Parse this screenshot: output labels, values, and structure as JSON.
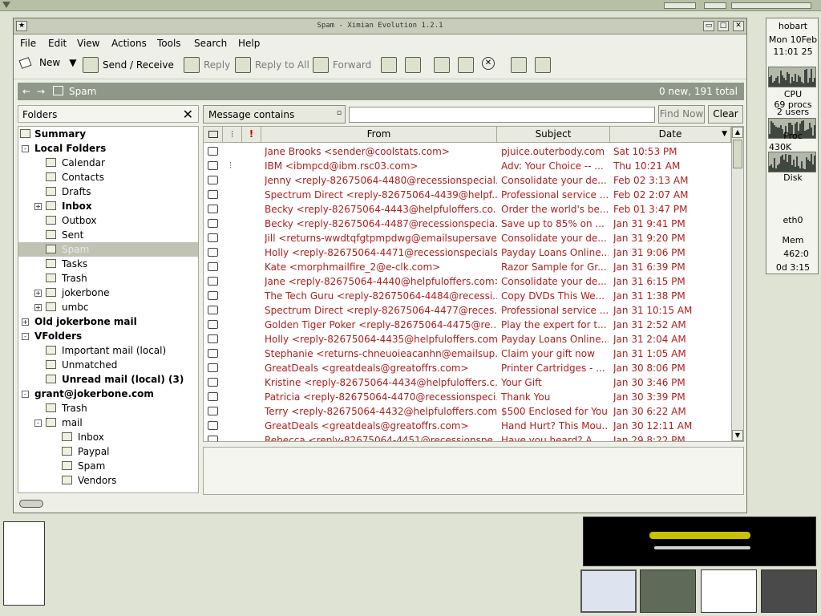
{
  "window": {
    "title": "Spam - Ximian Evolution 1.2.1"
  },
  "menu": [
    "File",
    "Edit",
    "View",
    "Actions",
    "Tools",
    "Search",
    "Help"
  ],
  "toolbar": {
    "new": "New",
    "send_receive": "Send / Receive",
    "reply": "Reply",
    "reply_all": "Reply to All",
    "forward": "Forward"
  },
  "pathbar": {
    "folder": "Spam",
    "status": "0 new, 191 total"
  },
  "sidebar": {
    "title": "Folders",
    "items": [
      {
        "label": "Summary",
        "bold": true,
        "level": 0
      },
      {
        "label": "Local Folders",
        "bold": true,
        "level": 0,
        "expander": "-"
      },
      {
        "label": "Calendar",
        "level": 1
      },
      {
        "label": "Contacts",
        "level": 1
      },
      {
        "label": "Drafts",
        "level": 1
      },
      {
        "label": "Inbox",
        "bold": true,
        "level": 1,
        "expander": "+"
      },
      {
        "label": "Outbox",
        "level": 1
      },
      {
        "label": "Sent",
        "level": 1
      },
      {
        "label": "Spam",
        "level": 1,
        "selected": true
      },
      {
        "label": "Tasks",
        "level": 1
      },
      {
        "label": "Trash",
        "level": 1
      },
      {
        "label": "jokerbone",
        "level": 1,
        "expander": "+"
      },
      {
        "label": "umbc",
        "level": 1,
        "expander": "+"
      },
      {
        "label": "Old jokerbone mail",
        "bold": true,
        "level": 0,
        "expander": "+"
      },
      {
        "label": "VFolders",
        "bold": true,
        "level": 0,
        "expander": "-"
      },
      {
        "label": "Important mail (local)",
        "level": 1
      },
      {
        "label": "Unmatched",
        "level": 1
      },
      {
        "label": "Unread mail (local) (3)",
        "bold": true,
        "level": 1
      },
      {
        "label": "grant@jokerbone.com",
        "bold": true,
        "level": 0,
        "expander": "-"
      },
      {
        "label": "Trash",
        "level": 1
      },
      {
        "label": "mail",
        "level": 1,
        "expander": "-"
      },
      {
        "label": "Inbox",
        "level": 2
      },
      {
        "label": "Paypal",
        "level": 2
      },
      {
        "label": "Spam",
        "level": 2
      },
      {
        "label": "Vendors",
        "level": 2
      }
    ]
  },
  "search": {
    "scope": "Message contains",
    "value": "",
    "find_now": "Find Now",
    "clear": "Clear"
  },
  "messages": {
    "columns": [
      "From",
      "Subject",
      "Date"
    ],
    "rows": [
      {
        "from": "Jane Brooks <sender@coolstats.com>",
        "subject": "pjuice.outerbody.com",
        "date": "Sat 10:53 PM",
        "attach": false
      },
      {
        "from": "IBM <ibmpcd@ibm.rsc03.com>",
        "subject": "Adv: Your Choice -- ...",
        "date": "Thu 10:21 AM",
        "attach": true
      },
      {
        "from": "Jenny <reply-82675064-4480@recessionspecial...",
        "subject": "Consolidate your de...",
        "date": "Feb 02 3:13 AM",
        "attach": false
      },
      {
        "from": "Spectrum Direct <reply-82675064-4439@helpf...",
        "subject": "Professional service ...",
        "date": "Feb 02 2:07 AM",
        "attach": false
      },
      {
        "from": "Becky <reply-82675064-4443@helpfuloffers.co...",
        "subject": "Order the world's be...",
        "date": "Feb 01 3:47 PM",
        "attach": false
      },
      {
        "from": "Becky <reply-82675064-4487@recessionspecia...",
        "subject": "Save up to 85% on ...",
        "date": "Jan 31 9:41 PM",
        "attach": false
      },
      {
        "from": "Jill <returns-wwdtqfgtpmpdwg@emailsupersave...",
        "subject": "Consolidate your de...",
        "date": "Jan 31 9:20 PM",
        "attach": false
      },
      {
        "from": "Holly <reply-82675064-4471@recessionspecials...",
        "subject": "Payday Loans Online...",
        "date": "Jan 31 9:06 PM",
        "attach": false
      },
      {
        "from": "Kate <morphmailfire_2@e-clk.com>",
        "subject": "Razor Sample for Gr...",
        "date": "Jan 31 6:39 PM",
        "attach": false
      },
      {
        "from": "Jane <reply-82675064-4440@helpfuloffers.com>",
        "subject": "Consolidate your de...",
        "date": "Jan 31 6:15 PM",
        "attach": false
      },
      {
        "from": "The Tech Guru <reply-82675064-4484@recessi...",
        "subject": "Copy DVDs This We...",
        "date": "Jan 31 1:38 PM",
        "attach": false
      },
      {
        "from": "Spectrum Direct <reply-82675064-4477@reces...",
        "subject": "Professional service ...",
        "date": "Jan 31 10:15 AM",
        "attach": false
      },
      {
        "from": "Golden Tiger Poker <reply-82675064-4475@re...",
        "subject": "Play the expert for t...",
        "date": "Jan 31 2:52 AM",
        "attach": false
      },
      {
        "from": "Holly <reply-82675064-4435@helpfuloffers.com>",
        "subject": "Payday Loans Online...",
        "date": "Jan 31 2:04 AM",
        "attach": false
      },
      {
        "from": "Stephanie <returns-chneuoieacanhn@emailsup...",
        "subject": "Claim your gift now",
        "date": "Jan 31 1:05 AM",
        "attach": false
      },
      {
        "from": "GreatDeals <greatdeals@greatoffrs.com>",
        "subject": "Printer Cartridges - ...",
        "date": "Jan 30 8:06 PM",
        "attach": false
      },
      {
        "from": "Kristine <reply-82675064-4434@helpfuloffers.c...",
        "subject": "Your Gift",
        "date": "Jan 30 3:46 PM",
        "attach": false
      },
      {
        "from": "Patricia <reply-82675064-4470@recessionspeci...",
        "subject": "Thank You",
        "date": "Jan 30 3:39 PM",
        "attach": false
      },
      {
        "from": "Terry <reply-82675064-4432@helpfuloffers.com>",
        "subject": "$500 Enclosed for You",
        "date": "Jan 30 6:22 AM",
        "attach": false
      },
      {
        "from": "GreatDeals <greatdeals@greatoffrs.com>",
        "subject": "Hand Hurt? This Mou...",
        "date": "Jan 30 12:11 AM",
        "attach": false
      },
      {
        "from": "Rebecca <reply-82675064-4451@recessionspe...",
        "subject": "Have you heard?  A ...",
        "date": "Jan 29 8:22 PM",
        "attach": false
      }
    ]
  },
  "sysmon": {
    "host": "hobart",
    "date": "Mon 10Feb",
    "time": "11:01 25",
    "cpu_label": "CPU",
    "procs": "69 procs",
    "users": "2 users",
    "proc_label": "Proc",
    "mem_k": "430K",
    "disk_label": "Disk",
    "net_label": "eth0",
    "mem_label": "Mem",
    "swap": "462",
    "swap_extra": "0",
    "uptime": "0d  3:15"
  },
  "colors": {
    "spam_text": "#b02020",
    "path_bar": "#8f9888",
    "desktop": "#dfe3d4"
  }
}
